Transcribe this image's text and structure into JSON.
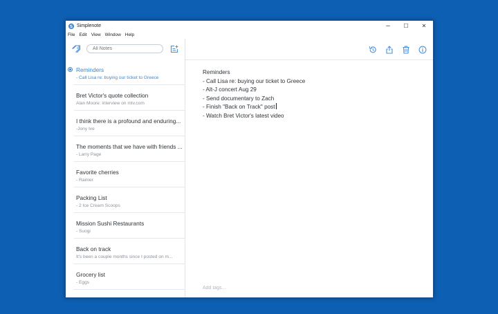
{
  "window": {
    "title": "Simplenote",
    "controls": {
      "minimize": "–",
      "maximize": "☐",
      "close": "✕"
    }
  },
  "menu": [
    "File",
    "Edit",
    "View",
    "Window",
    "Help"
  ],
  "sidebar": {
    "search_placeholder": "All Notes",
    "notes": [
      {
        "title": "Reminders",
        "preview": "- Call Lisa re: buying our ticket to Greece",
        "selected": true,
        "pinned": true
      },
      {
        "title": "Bret Victor's quote collection",
        "preview": "Alan Moore: interview on mtv.com"
      },
      {
        "title": "I think there is a profound and enduring...",
        "preview": "-Jony Ive"
      },
      {
        "title": "The moments that we have with friends ...",
        "preview": "- Larry Page"
      },
      {
        "title": "Favorite cherries",
        "preview": "- Rainier"
      },
      {
        "title": "Packing List",
        "preview": "- 2 Ice Cream Scoops"
      },
      {
        "title": "Mission Sushi Restaurants",
        "preview": "- Suogi"
      },
      {
        "title": "Back on track",
        "preview": "It's been a couple months since I posted on m..."
      },
      {
        "title": "Grocery list",
        "preview": "- Eggs"
      }
    ]
  },
  "editor": {
    "lines": [
      "Reminders",
      "- Call Lisa re: buying our ticket to Greece",
      "- Alt-J concert Aug 29",
      "- Send documentary to Zach",
      "- Finish \"Back on Track\" post",
      "- Watch Bret Victor's latest video"
    ],
    "tags_placeholder": "Add tags..."
  },
  "colors": {
    "desktop": "#0d5fb3",
    "accent": "#3a86d0",
    "icon": "#4a90d9"
  },
  "icons": {
    "tag": "tag-icon",
    "new_note": "new-note-icon",
    "history": "history-icon",
    "share": "share-icon",
    "trash": "trash-icon",
    "info": "info-icon"
  }
}
